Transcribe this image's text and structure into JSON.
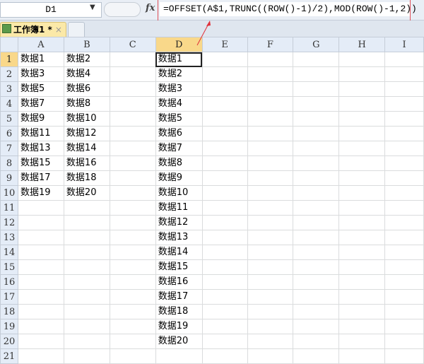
{
  "formula_bar": {
    "name_box": "D1",
    "fx": "fx",
    "formula": "=OFFSET(A$1,TRUNC((ROW()-1)/2),MOD(ROW()-1,2))"
  },
  "tabs": [
    {
      "label": "工作簿1 *",
      "close": "×"
    }
  ],
  "columns": [
    "A",
    "B",
    "C",
    "D",
    "E",
    "F",
    "G",
    "H",
    "I"
  ],
  "selected_cell": "D1",
  "rows": [
    {
      "n": "1",
      "A": "数据1",
      "B": "数据2",
      "D": "数据1"
    },
    {
      "n": "2",
      "A": "数据3",
      "B": "数据4",
      "D": "数据2"
    },
    {
      "n": "3",
      "A": "数据5",
      "B": "数据6",
      "D": "数据3"
    },
    {
      "n": "4",
      "A": "数据7",
      "B": "数据8",
      "D": "数据4"
    },
    {
      "n": "5",
      "A": "数据9",
      "B": "数据10",
      "D": "数据5"
    },
    {
      "n": "6",
      "A": "数据11",
      "B": "数据12",
      "D": "数据6"
    },
    {
      "n": "7",
      "A": "数据13",
      "B": "数据14",
      "D": "数据7"
    },
    {
      "n": "8",
      "A": "数据15",
      "B": "数据16",
      "D": "数据8"
    },
    {
      "n": "9",
      "A": "数据17",
      "B": "数据18",
      "D": "数据9"
    },
    {
      "n": "10",
      "A": "数据19",
      "B": "数据20",
      "D": "数据10"
    },
    {
      "n": "11",
      "D": "数据11"
    },
    {
      "n": "12",
      "D": "数据12"
    },
    {
      "n": "13",
      "D": "数据13"
    },
    {
      "n": "14",
      "D": "数据14"
    },
    {
      "n": "15",
      "D": "数据15"
    },
    {
      "n": "16",
      "D": "数据16"
    },
    {
      "n": "17",
      "D": "数据17"
    },
    {
      "n": "18",
      "D": "数据18"
    },
    {
      "n": "19",
      "D": "数据19"
    },
    {
      "n": "20",
      "D": "数据20"
    },
    {
      "n": "21"
    }
  ]
}
